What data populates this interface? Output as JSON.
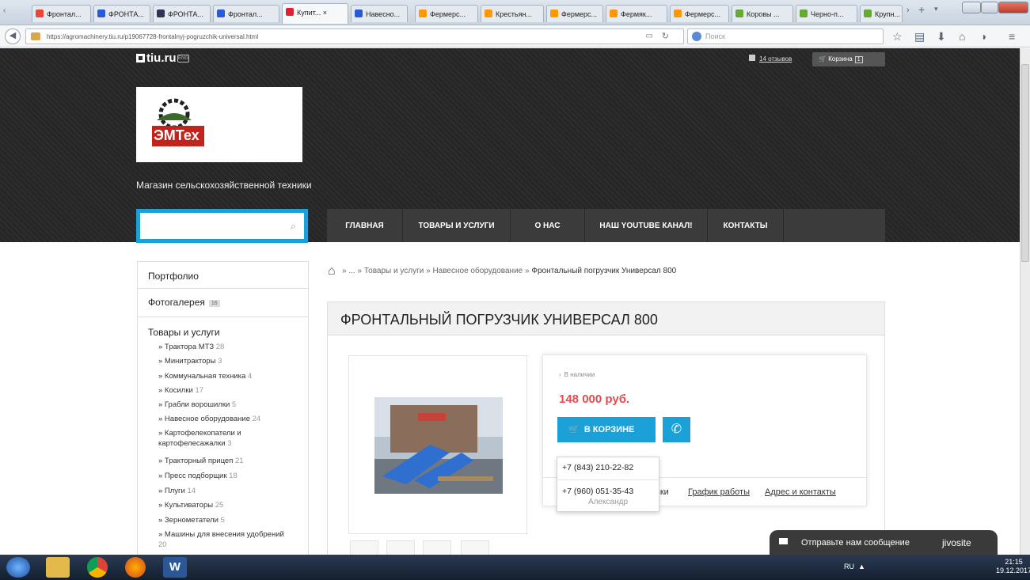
{
  "browser": {
    "tabs": [
      {
        "label": "Фронтал..."
      },
      {
        "label": "ФРОНТА..."
      },
      {
        "label": "ФРОНТА..."
      },
      {
        "label": "Фронтал..."
      },
      {
        "label": "Купит..."
      },
      {
        "label": "Навесно..."
      },
      {
        "label": "Фермерс..."
      },
      {
        "label": "Крестьян..."
      },
      {
        "label": "Фермерс..."
      },
      {
        "label": "Фермяк..."
      },
      {
        "label": "Фермерс..."
      },
      {
        "label": "Коровы ..."
      },
      {
        "label": "Черно-п..."
      },
      {
        "label": "Крупн..."
      }
    ],
    "active_tab_close": "×",
    "new_tab": "+",
    "url": "https://agromachinery.tiu.ru/p19067728-frontalnyj-pogruzchik-universal.html",
    "search_placeholder": "Поиск"
  },
  "site": {
    "tiu_logo": "tiu.ru",
    "tiu_badge": "ENG",
    "reviews_link": "14 отзывов",
    "cart_label": "Корзина",
    "cart_count": "1",
    "logo_text": "ЭМТех",
    "store_description": "Магазин сельскохозяйственной техники",
    "search_placeholder": ""
  },
  "menu": [
    {
      "label": "ГЛАВНАЯ"
    },
    {
      "label": "ТОВАРЫ И УСЛУГИ"
    },
    {
      "label": "О НАС"
    },
    {
      "label": "НАШ YOUTUBE КАНАЛ!"
    },
    {
      "label": "КОНТАКТЫ"
    }
  ],
  "sidebar": {
    "portfolio": "Портфолио",
    "gallery": "Фотогалерея",
    "gallery_count": "16",
    "products_title": "Товары и услуги",
    "categories": [
      {
        "label": "» Трактора МТЗ",
        "count": "28"
      },
      {
        "label": "» Минитракторы",
        "count": "3"
      },
      {
        "label": "» Коммунальная техника",
        "count": "4"
      },
      {
        "label": "» Косилки",
        "count": "17"
      },
      {
        "label": "» Грабли ворошилки",
        "count": "5"
      },
      {
        "label": "» Навесное оборудование",
        "count": "24"
      },
      {
        "label": "» Картофелекопатели и картофелесажалки",
        "count": "3"
      },
      {
        "label": "» Тракторный прицеп",
        "count": "21"
      },
      {
        "label": "» Пресс подборщик",
        "count": "18"
      },
      {
        "label": "» Плуги",
        "count": "14"
      },
      {
        "label": "» Культиваторы",
        "count": "25"
      },
      {
        "label": "» Зерномeтатели",
        "count": "5"
      },
      {
        "label": "» Машины для внесения удобрений",
        "count": "20"
      }
    ]
  },
  "breadcrumb": {
    "sep1": "»",
    "ellipsis": "...",
    "sep2": "»",
    "item1": "Товары и услуги",
    "sep3": "»",
    "item2": "Навесное оборудование",
    "sep4": "»",
    "current": "Фронтальный погрузчик Универсал 800"
  },
  "product": {
    "title": "ФРОНТАЛЬНЫЙ ПОГРУЗЧИК УНИВЕРСАЛ 800",
    "stock": "В наличии",
    "price": "148 000 руб.",
    "cart_button": "В КОРЗИНЕ",
    "tabs": [
      {
        "label": "вки"
      },
      {
        "label": "График работы"
      },
      {
        "label": "Адрес и контакты"
      }
    ]
  },
  "phones": {
    "phone1": "+7 (843) 210-22-82",
    "phone2": "+7 (960) 051-35-43",
    "contact_name": "Александр"
  },
  "jivo": {
    "message": "Отправьте нам сообщение",
    "brand": "jivosite"
  },
  "taskbar": {
    "lang": "RU",
    "time": "21:15",
    "date": "19.12.2017"
  },
  "colors": {
    "accent": "#1ba1d8",
    "price": "#e74c4c",
    "header_bg": "#262626",
    "menu_bg": "#3b3b3b"
  }
}
